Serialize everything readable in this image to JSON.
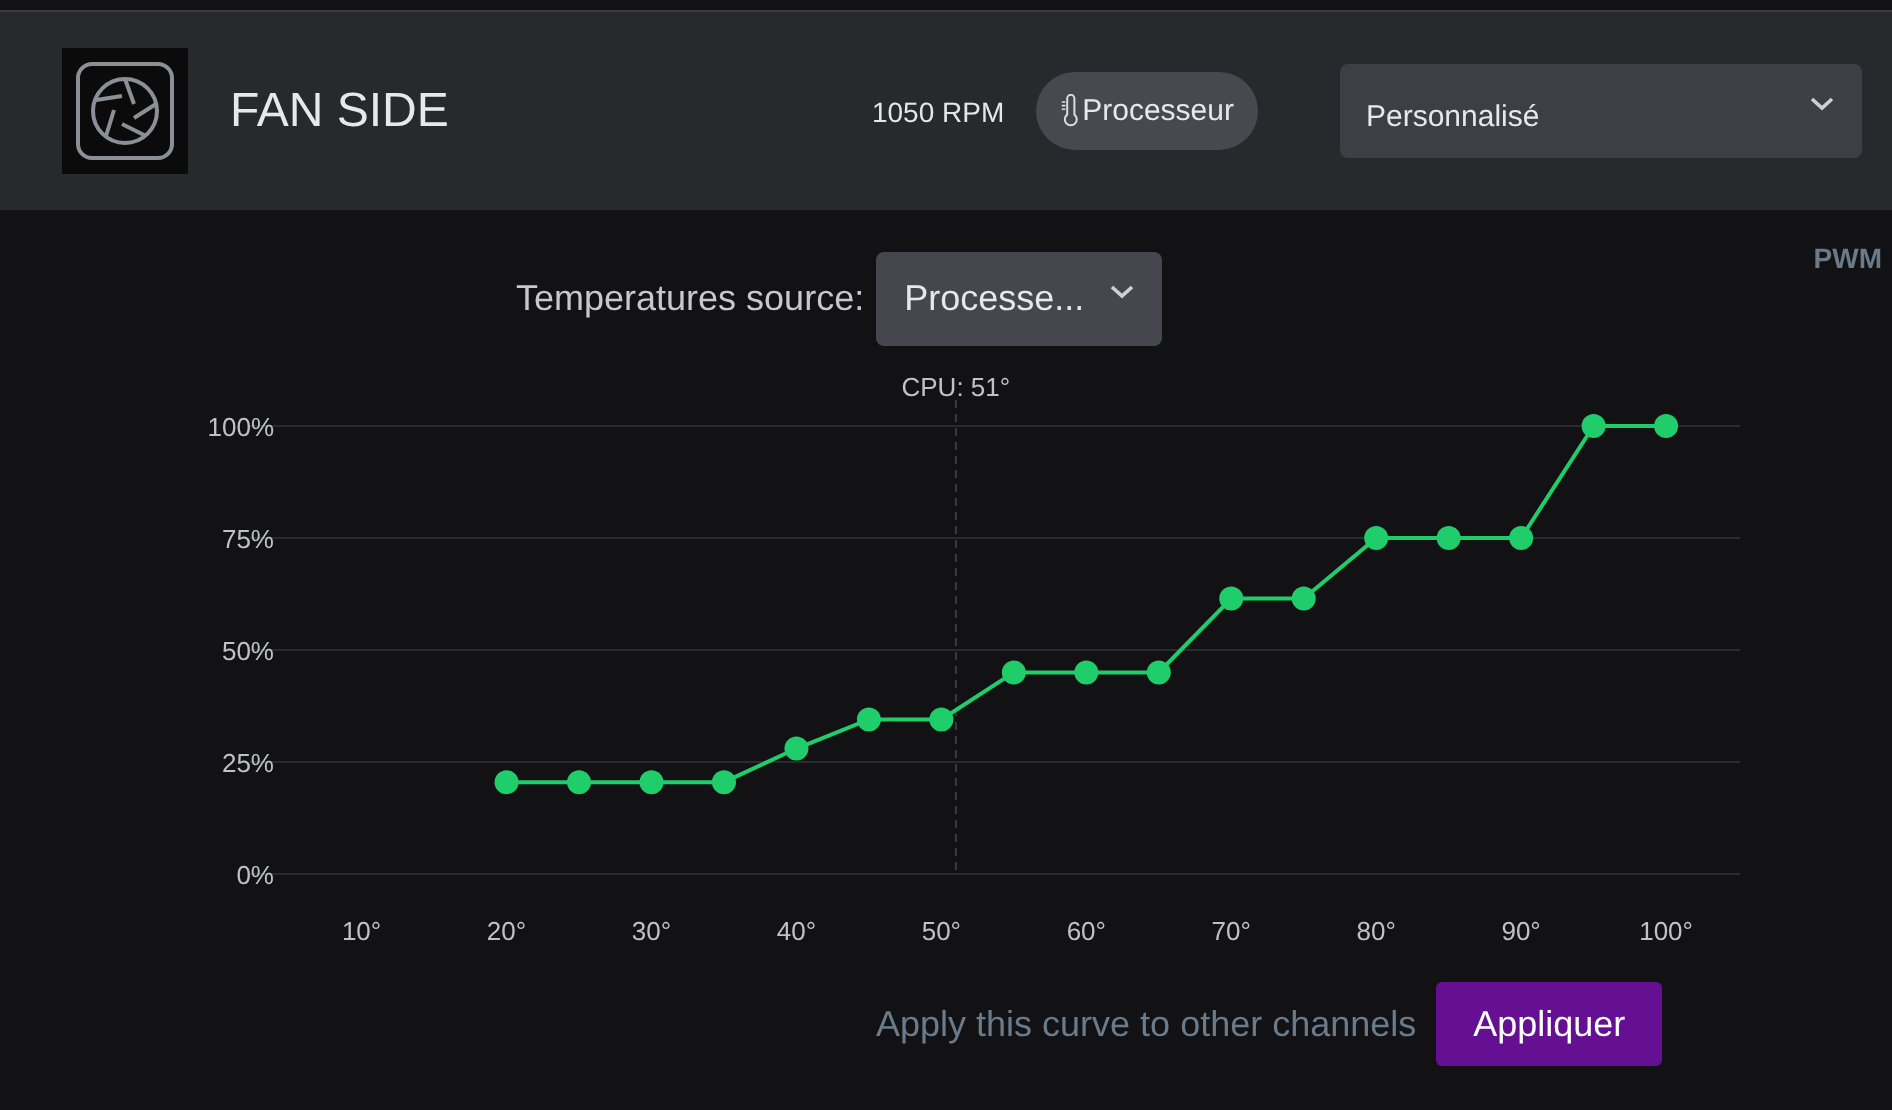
{
  "header": {
    "title": "FAN SIDE",
    "rpm": "1050 RPM",
    "source_button": "Processeur",
    "profile_select": {
      "value": "Personnalisé"
    }
  },
  "curve_editor": {
    "source_label": "Temperatures source:",
    "source_select": {
      "value": "Processe..."
    },
    "axis_label": "PWM",
    "chart_data": {
      "type": "line",
      "grid": true,
      "x": [
        20,
        25,
        30,
        35,
        40,
        45,
        50,
        55,
        60,
        65,
        70,
        75,
        80,
        85,
        90,
        95,
        100
      ],
      "series": [
        {
          "color": "#1fce6a",
          "marker": "circle",
          "values": [
            20.5,
            20.5,
            20.5,
            20.5,
            28,
            34.5,
            34.5,
            45,
            45,
            45,
            61.5,
            61.5,
            75,
            75,
            75,
            100,
            100
          ]
        }
      ],
      "xlim": [
        2.3,
        105.1
      ],
      "ylim": [
        0,
        100
      ],
      "xticks": [
        {
          "value": 10,
          "label": "10°"
        },
        {
          "value": 20,
          "label": "20°"
        },
        {
          "value": 30,
          "label": "30°"
        },
        {
          "value": 40,
          "label": "40°"
        },
        {
          "value": 50,
          "label": "50°"
        },
        {
          "value": 60,
          "label": "60°"
        },
        {
          "value": 70,
          "label": "70°"
        },
        {
          "value": 80,
          "label": "80°"
        },
        {
          "value": 90,
          "label": "90°"
        },
        {
          "value": 100,
          "label": "100°"
        }
      ],
      "yticks": [
        {
          "value": 0,
          "label": "0%"
        },
        {
          "value": 25,
          "label": "25%"
        },
        {
          "value": 50,
          "label": "50%"
        },
        {
          "value": 75,
          "label": "75%"
        },
        {
          "value": 100,
          "label": "100%"
        }
      ],
      "ref_lines": [
        {
          "axis": "x",
          "value": 51,
          "label": "CPU: 51°"
        }
      ]
    },
    "apply_hint": "Apply this curve to other channels",
    "apply_button": "Appliquer"
  }
}
